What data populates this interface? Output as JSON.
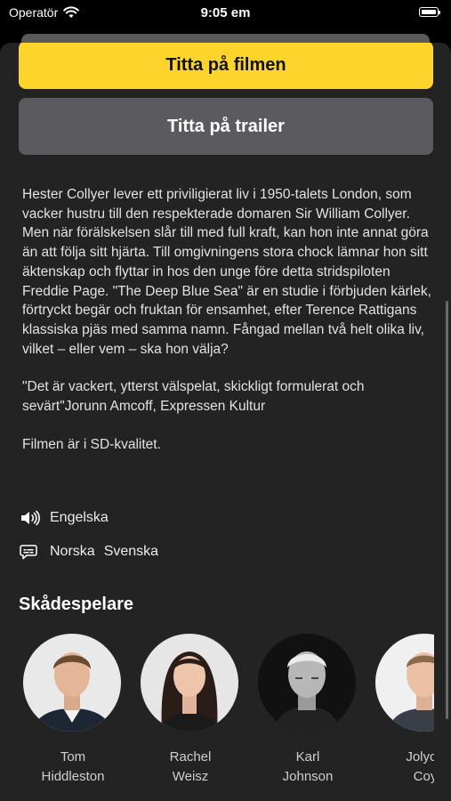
{
  "status_bar": {
    "carrier": "Operatör",
    "time": "9:05 em",
    "icons": [
      "wifi-icon",
      "battery-icon"
    ]
  },
  "actions": {
    "watch_label": "Titta på filmen",
    "trailer_label": "Titta på trailer",
    "accent_color": "#fdd42c"
  },
  "description": {
    "paragraphs": [
      "Hester Collyer lever ett priviligierat liv i 1950-talets London, som vacker hustru till den respekterade domaren Sir William Collyer. Men när förälskelsen slår till med full kraft, kan hon inte annat göra än att följa sitt hjärta. Till omgivningens stora chock lämnar hon sitt äktenskap och flyttar in hos den unge före detta stridspiloten Freddie Page. \"The Deep Blue Sea\" är en studie i förbjuden kärlek, förtryckt begär och fruktan för ensamhet, efter Terence Rattigans klassiska pjäs med samma namn. Fångad mellan två helt olika liv, vilket – eller vem – ska hon välja?",
      "\"Det är vackert, ytterst välspelat, skickligt formulerat och sevärt\"Jorunn Amcoff, Expressen Kultur",
      "Filmen är i SD-kvalitet."
    ]
  },
  "languages": {
    "audio_icon": "speaker-icon",
    "audio": [
      "Engelska"
    ],
    "subtitles_icon": "subtitles-icon",
    "subtitles": [
      "Norska",
      "Svenska"
    ]
  },
  "cast": {
    "title": "Skådespelare",
    "members": [
      {
        "first": "Tom",
        "last": "Hiddleston"
      },
      {
        "first": "Rachel",
        "last": "Weisz"
      },
      {
        "first": "Karl",
        "last": "Johnson"
      },
      {
        "first": "Jolyon",
        "last": "Coy"
      }
    ]
  }
}
